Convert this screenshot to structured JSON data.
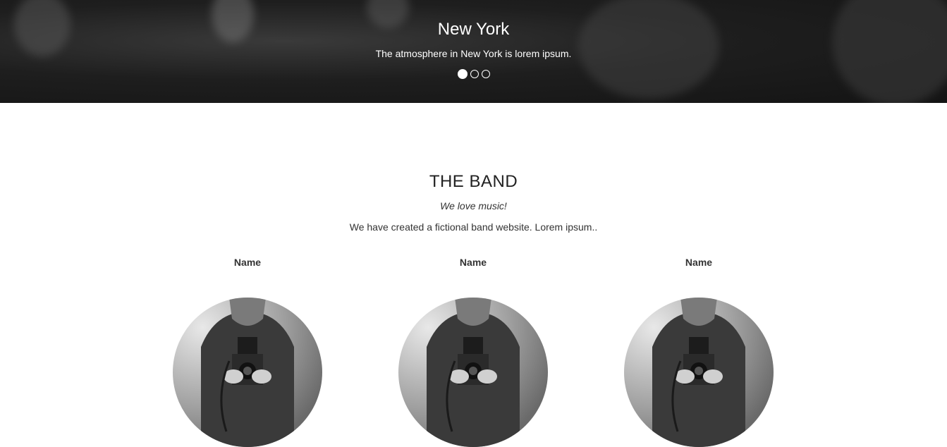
{
  "carousel": {
    "slide_title": "New York",
    "slide_text": "The atmosphere in New York is lorem ipsum.",
    "indicators": [
      "slide-1",
      "slide-2",
      "slide-3"
    ],
    "active_index": 0
  },
  "band": {
    "title": "THE BAND",
    "tagline": "We love music!",
    "description": "We have created a fictional band website. Lorem ipsum..",
    "members": [
      {
        "name": "Name"
      },
      {
        "name": "Name"
      },
      {
        "name": "Name"
      }
    ]
  }
}
